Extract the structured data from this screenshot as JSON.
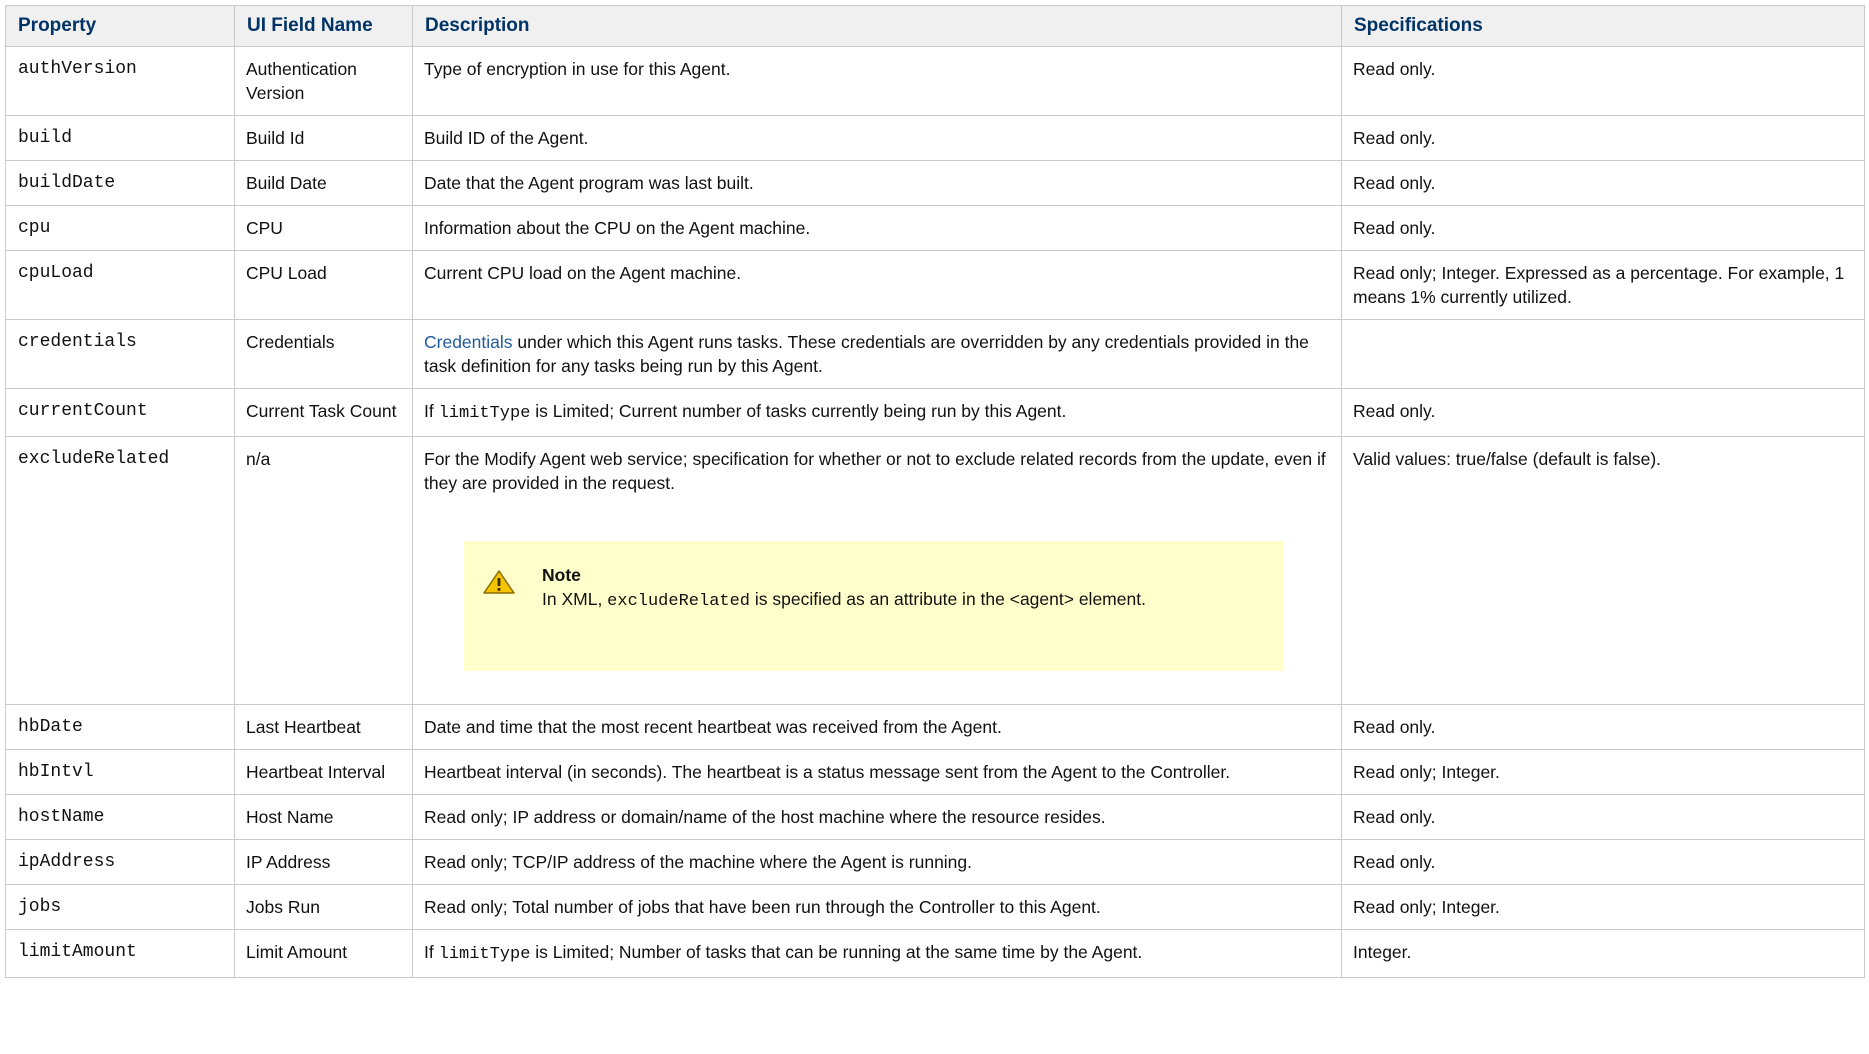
{
  "headers": {
    "property": "Property",
    "ui_field": "UI Field Name",
    "description": "Description",
    "specifications": "Specifications"
  },
  "rows": [
    {
      "property": "authVersion",
      "ui_field": "Authentication Version",
      "description": "Type of encryption in use for this Agent.",
      "spec": "Read only."
    },
    {
      "property": "build",
      "ui_field": "Build Id",
      "description": "Build ID of the Agent.",
      "spec": "Read only."
    },
    {
      "property": "buildDate",
      "ui_field": "Build Date",
      "description": "Date that the Agent program was last built.",
      "spec": "Read only."
    },
    {
      "property": "cpu",
      "ui_field": "CPU",
      "description": "Information about the CPU on the Agent machine.",
      "spec": "Read only."
    },
    {
      "property": "cpuLoad",
      "ui_field": "CPU Load",
      "description": "Current CPU load on the Agent machine.",
      "spec": "Read only; Integer. Expressed as a percentage. For example, 1 means 1% currently utilized."
    },
    {
      "property": "credentials",
      "ui_field": "Credentials",
      "description_link": "Credentials",
      "description_rest": " under which this Agent runs tasks. These credentials are overridden by any credentials provided in the task definition for any tasks being run by this Agent.",
      "spec": ""
    },
    {
      "property": "currentCount",
      "ui_field": "Current Task Count",
      "description_pre": "If ",
      "description_code": "limitType",
      "description_post": " is Limited; Current number of tasks currently being run by this Agent.",
      "spec": "Read only."
    },
    {
      "property": "excludeRelated",
      "ui_field": "n/a",
      "description": "For the Modify Agent web service; specification for whether or not to exclude related records from the update, even if they are provided in the request.",
      "note": {
        "icon": "warning-icon",
        "title": "Note",
        "text_pre": "In XML, ",
        "text_code": "excludeRelated",
        "text_post": " is specified as an attribute in the <agent> element."
      },
      "spec": "Valid values: true/false (default is false)."
    },
    {
      "property": "hbDate",
      "ui_field": "Last Heartbeat",
      "description": "Date and time that the most recent heartbeat was received from the Agent.",
      "spec": "Read only."
    },
    {
      "property": "hbIntvl",
      "ui_field": "Heartbeat Interval",
      "description": "Heartbeat interval (in seconds). The heartbeat is a status message sent from the Agent to the Controller.",
      "spec": "Read only; Integer."
    },
    {
      "property": "hostName",
      "ui_field": "Host Name",
      "description": "Read only; IP address or domain/name of the host machine where the resource resides.",
      "spec": "Read only."
    },
    {
      "property": "ipAddress",
      "ui_field": "IP Address",
      "description": "Read only; TCP/IP address of the machine where the Agent is running.",
      "spec": "Read only."
    },
    {
      "property": "jobs",
      "ui_field": "Jobs Run",
      "description": "Read only; Total number of jobs that have been run through the Controller to this Agent.",
      "spec": "Read only; Integer."
    },
    {
      "property": "limitAmount",
      "ui_field": "Limit Amount",
      "description_pre": "If ",
      "description_code": "limitType",
      "description_post": " is Limited; Number of tasks that can be running at the same time by the Agent.",
      "spec": "Integer."
    }
  ],
  "colors": {
    "header_bg": "#f0f0f0",
    "header_text": "#003366",
    "border": "#c9c9c9",
    "link": "#1f5a9c",
    "note_bg": "#ffffcc"
  }
}
